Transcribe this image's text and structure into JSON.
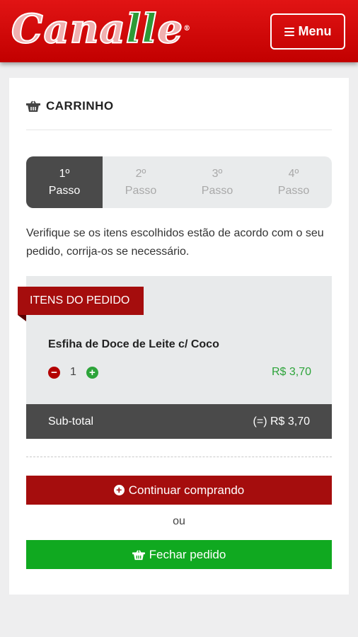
{
  "header": {
    "logo_text": "Canalle",
    "menu_label": "Menu"
  },
  "cart": {
    "title": "CARRINHO",
    "steps": [
      {
        "number": "1º",
        "label": "Passo",
        "active": true
      },
      {
        "number": "2º",
        "label": "Passo",
        "active": false
      },
      {
        "number": "3º",
        "label": "Passo",
        "active": false
      },
      {
        "number": "4º",
        "label": "Passo",
        "active": false
      }
    ],
    "intro_text": "Verifique se os itens escolhidos estão de acordo com o seu pedido, corrija-os se necessário.",
    "items_label": "ITENS DO PEDIDO",
    "items": [
      {
        "name": "Esfiha de Doce de Leite c/ Coco",
        "quantity": "1",
        "price": "R$ 3,70"
      }
    ],
    "subtotal_label": "Sub-total",
    "subtotal_value": "(=) R$ 3,70",
    "continue_label": "Continuar comprando",
    "or_label": "ou",
    "close_label": "Fechar pedido"
  },
  "colors": {
    "header_red": "#d80a0a",
    "ribbon_red": "#a50d0d",
    "green": "#10a920",
    "dark_gray": "#4a4a4a"
  },
  "icons": [
    "hamburger-icon",
    "basket-icon",
    "minus-circle-icon",
    "plus-circle-icon"
  ]
}
